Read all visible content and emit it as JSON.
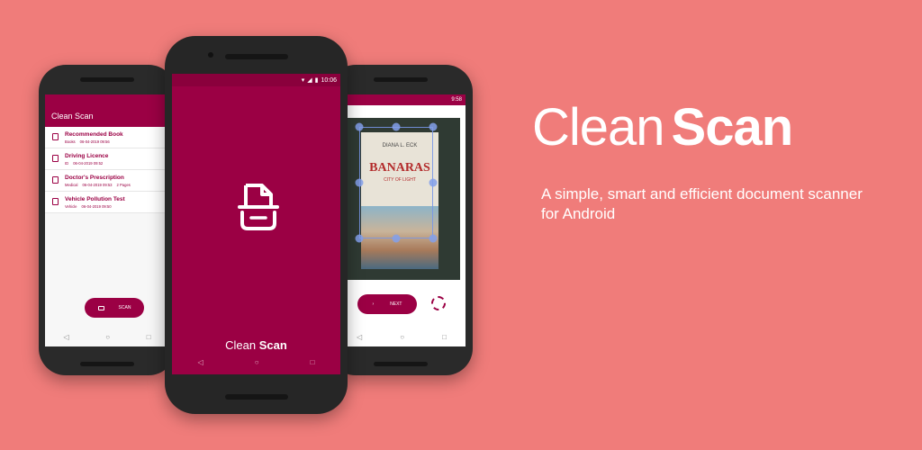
{
  "hero": {
    "title_light": "Clean",
    "title_bold": "Scan",
    "tagline": "A simple, smart and efficient document scanner for Android"
  },
  "left_phone": {
    "app_title": "Clean Scan",
    "documents": [
      {
        "title": "Recommended Book",
        "category": "Books",
        "date": "06-04-2019 09:56",
        "pages": ""
      },
      {
        "title": "Driving Licence",
        "category": "ID",
        "date": "06-04-2019 09:52",
        "pages": ""
      },
      {
        "title": "Doctor's Prescription",
        "category": "Medical",
        "date": "06-04-2019 09:53",
        "pages": "2 Pages"
      },
      {
        "title": "Vehicle Pollution Test",
        "category": "Vehicle",
        "date": "06-04-2019 09:50",
        "pages": ""
      }
    ],
    "scan_label": "SCAN"
  },
  "center_phone": {
    "time": "10:06",
    "brand_light": "Clean",
    "brand_bold": "Scan"
  },
  "right_phone": {
    "time": "9:58",
    "book_author": "DIANA L. ECK",
    "book_title": "BANARAS",
    "book_subtitle": "CITY OF LIGHT",
    "next_label": "NEXT"
  },
  "nav": {
    "back": "◁",
    "home": "○",
    "recents": "□"
  },
  "colors": {
    "background": "#f07c7a",
    "brand": "#9b0044",
    "text": "#ffffff"
  }
}
